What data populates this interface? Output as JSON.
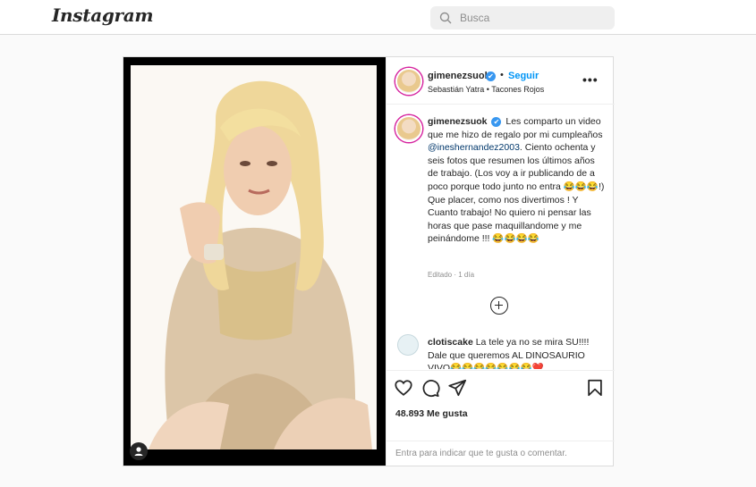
{
  "app": {
    "logo_text": "Instagram"
  },
  "search": {
    "placeholder": "Busca"
  },
  "post": {
    "username": "gimenezsuok",
    "verified": "✔",
    "separator": "•",
    "follow_label": "Seguir",
    "music": "Sebastián Yatra • Tacones Rojos",
    "more_label": "•••",
    "caption": {
      "text_1": "Les comparto un video que me hizo de regalo por mi cumpleaños ",
      "mention": "@ineshernandez2003",
      "text_2": ". Ciento ochenta y seis fotos que resumen los últimos años de trabajo. (Los voy a ir publicando de a poco porque todo junto no entra 😂😂😂!) Que placer, como nos divertimos ! Y Cuanto trabajo! No quiero ni pensar las horas que pase maquillandome y me peinándome !!! 😂😂😂😂"
    },
    "edited": "Editado · 1 día",
    "comment": {
      "username": "clotiscake",
      "text": "La tele ya no se mira SU!!!! Dale que queremos AL DINOSAURIO VIVO😂😂😂😂😂😂😂❤️"
    },
    "likes": "48.893 Me gusta",
    "add_comment": "Entra para indicar que te gusta o comentar."
  },
  "colors": {
    "accent": "#0095f6",
    "mention": "#00376b",
    "border": "#dbdbdb"
  },
  "icons": [
    "search-icon",
    "verified-icon",
    "more-icon",
    "add-circle-icon",
    "heart-icon",
    "comment-icon",
    "share-icon",
    "bookmark-icon",
    "tag-user-icon"
  ]
}
